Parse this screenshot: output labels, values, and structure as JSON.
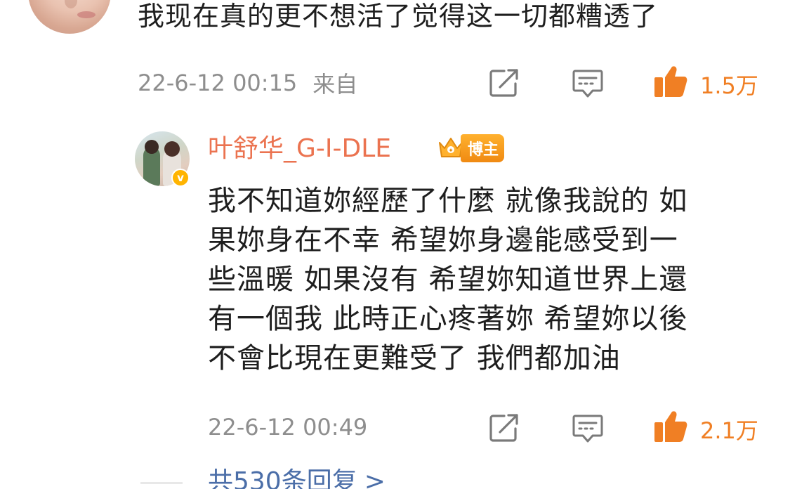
{
  "top_comment": {
    "text": "我现在真的更不想活了觉得这一切都糟透了",
    "timestamp": "22-6-12 00:15",
    "source": "来自",
    "actions": {
      "share_icon": "share-icon",
      "comment_icon": "comment-icon",
      "like_icon": "thumbs-up-icon"
    },
    "like_count": "1.5万"
  },
  "reply": {
    "username": "叶舒华_G-I-DLE",
    "badge_label": "博主",
    "verify_mark": "v",
    "lines": [
      "我不知道妳經歷了什麼 就像我說的 如",
      "果妳身在不幸 希望妳身邊能感受到一",
      "些溫暖 如果沒有 希望妳知道世界上還",
      "有一個我 此時正心疼著妳 希望妳以後",
      "不會比現在更難受了 我們都加油"
    ],
    "timestamp": "22-6-12 00:49",
    "like_count": "2.1万"
  },
  "more_replies": {
    "label": "共530条回复",
    "chevron": ">"
  },
  "colors": {
    "text_primary": "#1e1e1e",
    "meta_gray": "#8e8e8e",
    "like_orange": "#f07f24",
    "username_orange": "#eb7350",
    "link_blue": "#4b6ea8",
    "badge_gold": "#ffb400"
  }
}
